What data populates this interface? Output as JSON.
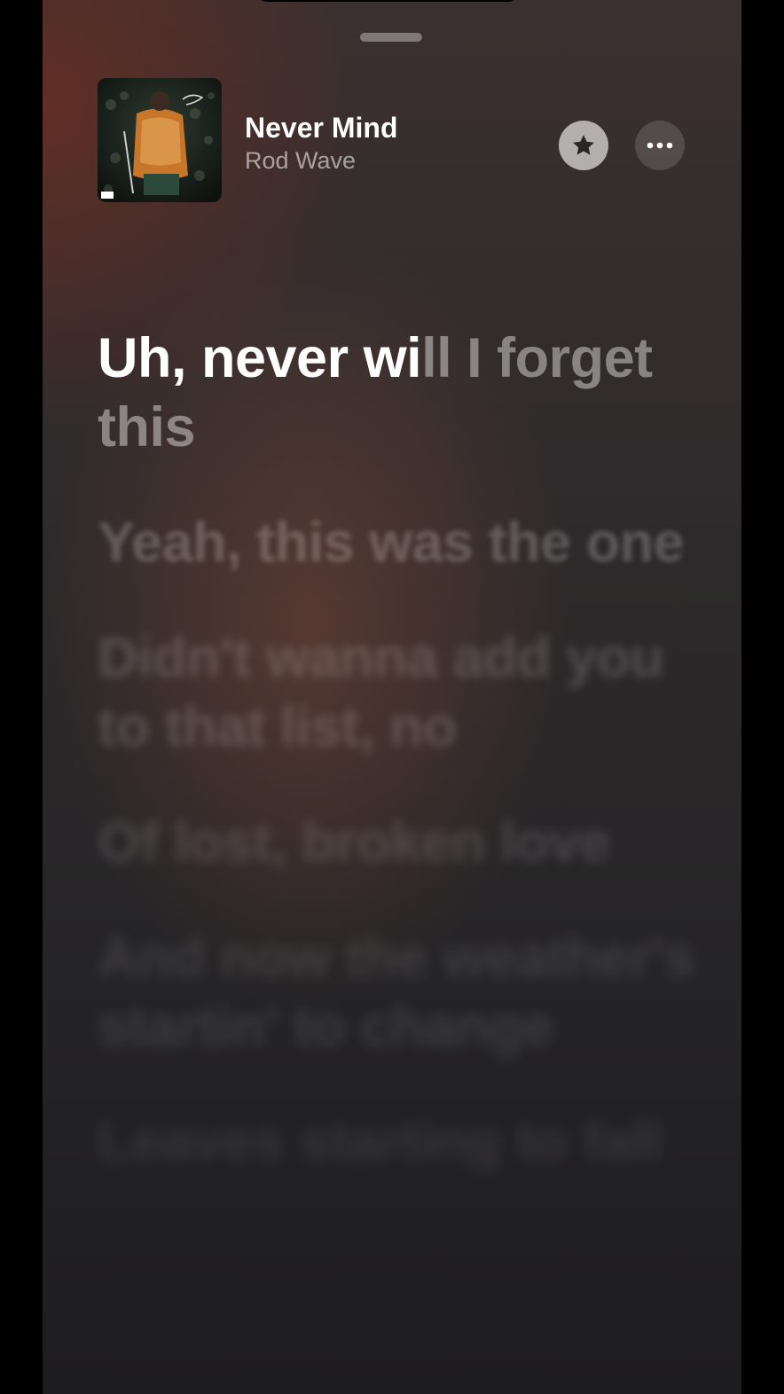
{
  "now_playing": {
    "title": "Never Mind",
    "artist": "Rod Wave",
    "artwork_icon": "album-artwork",
    "favorite_icon": "star-icon",
    "more_icon": "more-icon"
  },
  "lyrics": {
    "current": {
      "sung": "Uh, never wi",
      "unsung": "ll I forget this"
    },
    "upcoming": [
      "Yeah, this was the one",
      "Didn't wanna add you to that list, no",
      "Of lost, broken love",
      "And now the weather's startin' to change",
      "Leaves starting to fall"
    ]
  },
  "colors": {
    "accent_white": "#ffffff",
    "background_dark": "#252426",
    "background_warm": "#6e2d23"
  }
}
